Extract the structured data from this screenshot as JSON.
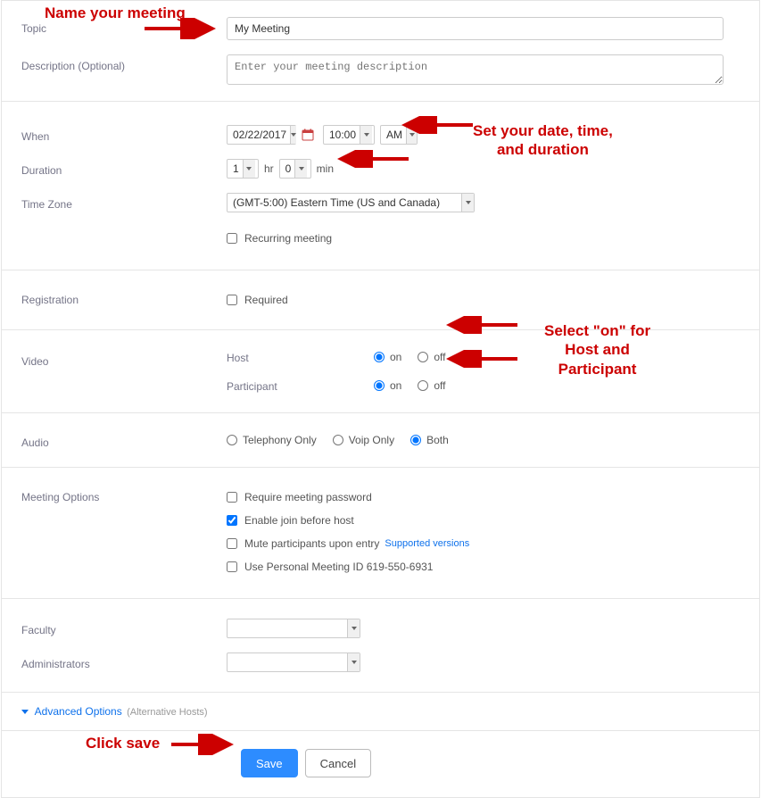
{
  "labels": {
    "topic": "Topic",
    "description": "Description (Optional)",
    "when": "When",
    "duration": "Duration",
    "timezone": "Time Zone",
    "registration": "Registration",
    "video": "Video",
    "audio": "Audio",
    "meeting_options": "Meeting Options",
    "faculty": "Faculty",
    "administrators": "Administrators"
  },
  "topic": {
    "value": "My Meeting"
  },
  "description": {
    "placeholder": "Enter your meeting description"
  },
  "when": {
    "date": "02/22/2017",
    "time": "10:00",
    "ampm": "AM"
  },
  "duration": {
    "hours": "1",
    "hr_unit": "hr",
    "minutes": "0",
    "min_unit": "min"
  },
  "timezone": {
    "value": "(GMT-5:00) Eastern Time (US and Canada)"
  },
  "recurring": {
    "label": "Recurring meeting",
    "checked": false
  },
  "registration": {
    "required_label": "Required",
    "checked": false
  },
  "video": {
    "host_label": "Host",
    "participant_label": "Participant",
    "on_label": "on",
    "off_label": "off",
    "host_value": "on",
    "participant_value": "on"
  },
  "audio": {
    "telephony": "Telephony Only",
    "voip": "Voip Only",
    "both": "Both",
    "value": "both"
  },
  "options": {
    "password": {
      "label": "Require meeting password",
      "checked": false
    },
    "join_before": {
      "label": "Enable join before host",
      "checked": true
    },
    "mute": {
      "label": "Mute participants upon entry",
      "checked": false,
      "supported_link": "Supported versions"
    },
    "pmi": {
      "label": "Use Personal Meeting ID 619-550-6931",
      "checked": false
    }
  },
  "faculty": {
    "value": ""
  },
  "administrators": {
    "value": ""
  },
  "advanced": {
    "label": "Advanced Options",
    "paren": "(Alternative Hosts)"
  },
  "footer": {
    "save": "Save",
    "cancel": "Cancel"
  },
  "annotations": {
    "name_meeting": "Name your meeting",
    "date_time": "Set your date, time,\nand duration",
    "video_on": "Select \"on\" for\nHost and\nParticipant",
    "click_save": "Click save"
  }
}
